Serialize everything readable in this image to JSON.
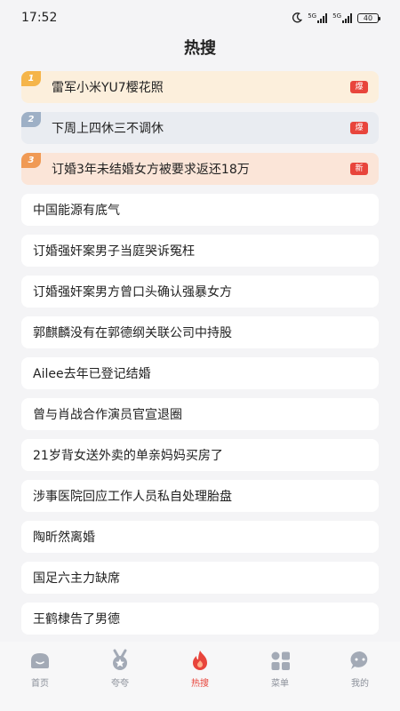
{
  "status_bar": {
    "time": "17:52",
    "net1": "5G",
    "net2": "5G",
    "battery": "40",
    "moon_icon": "moon-icon",
    "signal_icon": "signal-icon",
    "battery_icon": "battery-icon"
  },
  "page": {
    "title": "热搜"
  },
  "colors": {
    "rank1": "#f5b54a",
    "rank2": "#9eb0c6",
    "rank3": "#f09a55",
    "badge": "#e8453c",
    "active_tab": "#e8453c",
    "inactive_tab": "#8a8f99"
  },
  "items": [
    {
      "rank": "1",
      "title": "雷军小米YU7樱花照",
      "badge": "爆"
    },
    {
      "rank": "2",
      "title": "下周上四休三不调休",
      "badge": "爆"
    },
    {
      "rank": "3",
      "title": "订婚3年未结婚女方被要求返还18万",
      "badge": "新"
    },
    {
      "title": "中国能源有底气"
    },
    {
      "title": "订婚强奸案男子当庭哭诉冤枉"
    },
    {
      "title": "订婚强奸案男方曾口头确认强暴女方"
    },
    {
      "title": "郭麒麟没有在郭德纲关联公司中持股"
    },
    {
      "title": "Ailee去年已登记结婚"
    },
    {
      "title": "曾与肖战合作演员官宣退圈"
    },
    {
      "title": "21岁背女送外卖的单亲妈妈买房了"
    },
    {
      "title": "涉事医院回应工作人员私自处理胎盘"
    },
    {
      "title": "陶昕然离婚"
    },
    {
      "title": "国足六主力缺席"
    },
    {
      "title": "王鹤棣告了男德"
    }
  ],
  "tabs": [
    {
      "label": "首页",
      "icon": "home-icon"
    },
    {
      "label": "夸夸",
      "icon": "medal-icon"
    },
    {
      "label": "热搜",
      "icon": "flame-icon",
      "active": true
    },
    {
      "label": "菜单",
      "icon": "grid-icon"
    },
    {
      "label": "我的",
      "icon": "chat-bubble-icon"
    }
  ]
}
